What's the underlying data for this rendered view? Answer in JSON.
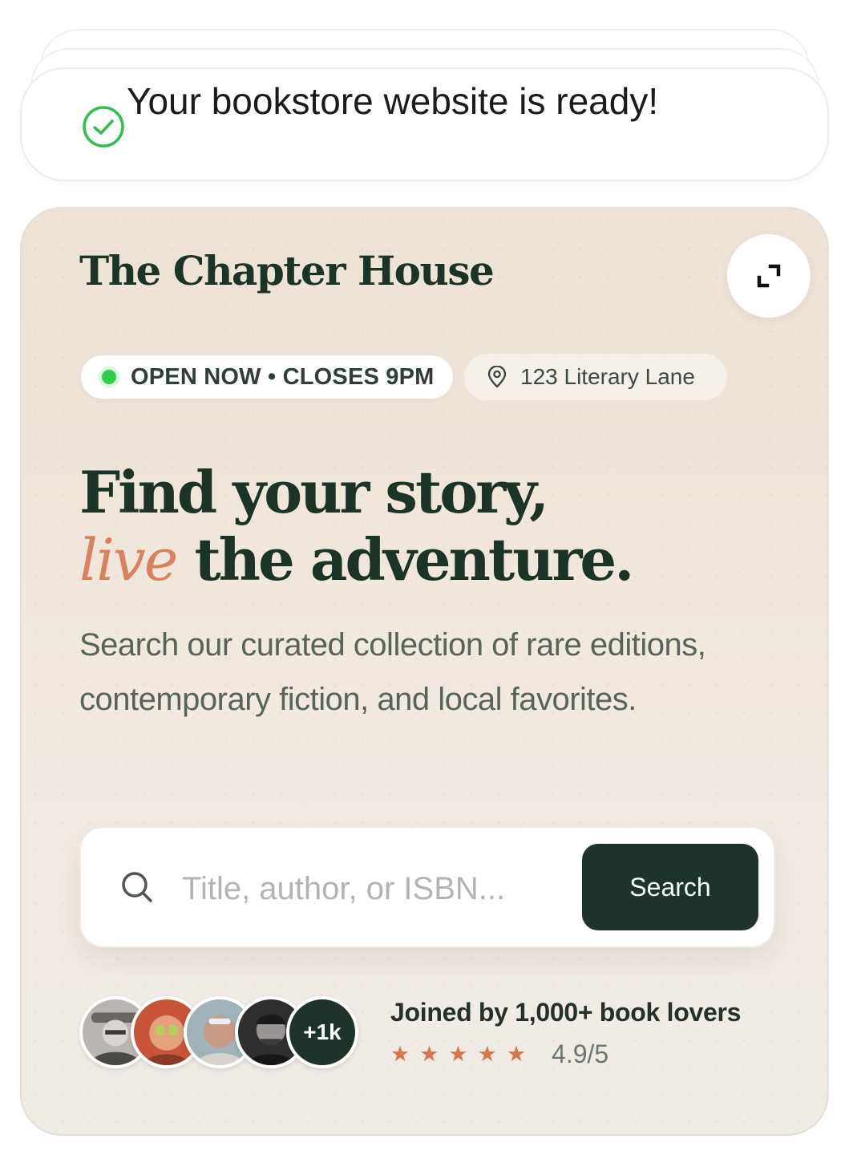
{
  "toast": {
    "message": "Your bookstore website is ready!",
    "icon": "check-circle-icon",
    "icon_color": "#2fbf4f"
  },
  "site": {
    "brand_name": "The Chapter House",
    "expand_icon": "expand-icon",
    "status_badge": "OPEN NOW • CLOSES 9PM",
    "status_dot_color": "#2ecc4a",
    "address": "123 Literary Lane",
    "address_icon": "map-pin-icon",
    "headline_line1": "Find your story,",
    "headline_accent": "live",
    "headline_line2_rest": " the adventure.",
    "description": "Search our curated collection of rare editions, contemporary fiction, and local favorites.",
    "search": {
      "placeholder": "Title, author, or ISBN...",
      "value": "",
      "button_label": "Search",
      "icon": "search-icon"
    },
    "social_proof": {
      "extra_count": "+1k",
      "joined_text": "Joined by 1,000+ book lovers",
      "stars": "★★★★★",
      "star_rating": 5,
      "rating": "4.9/5"
    }
  },
  "colors": {
    "brand_dark": "#1c3328",
    "accent": "#d9825f",
    "star": "#d9744d",
    "button_bg": "#1e342a"
  }
}
